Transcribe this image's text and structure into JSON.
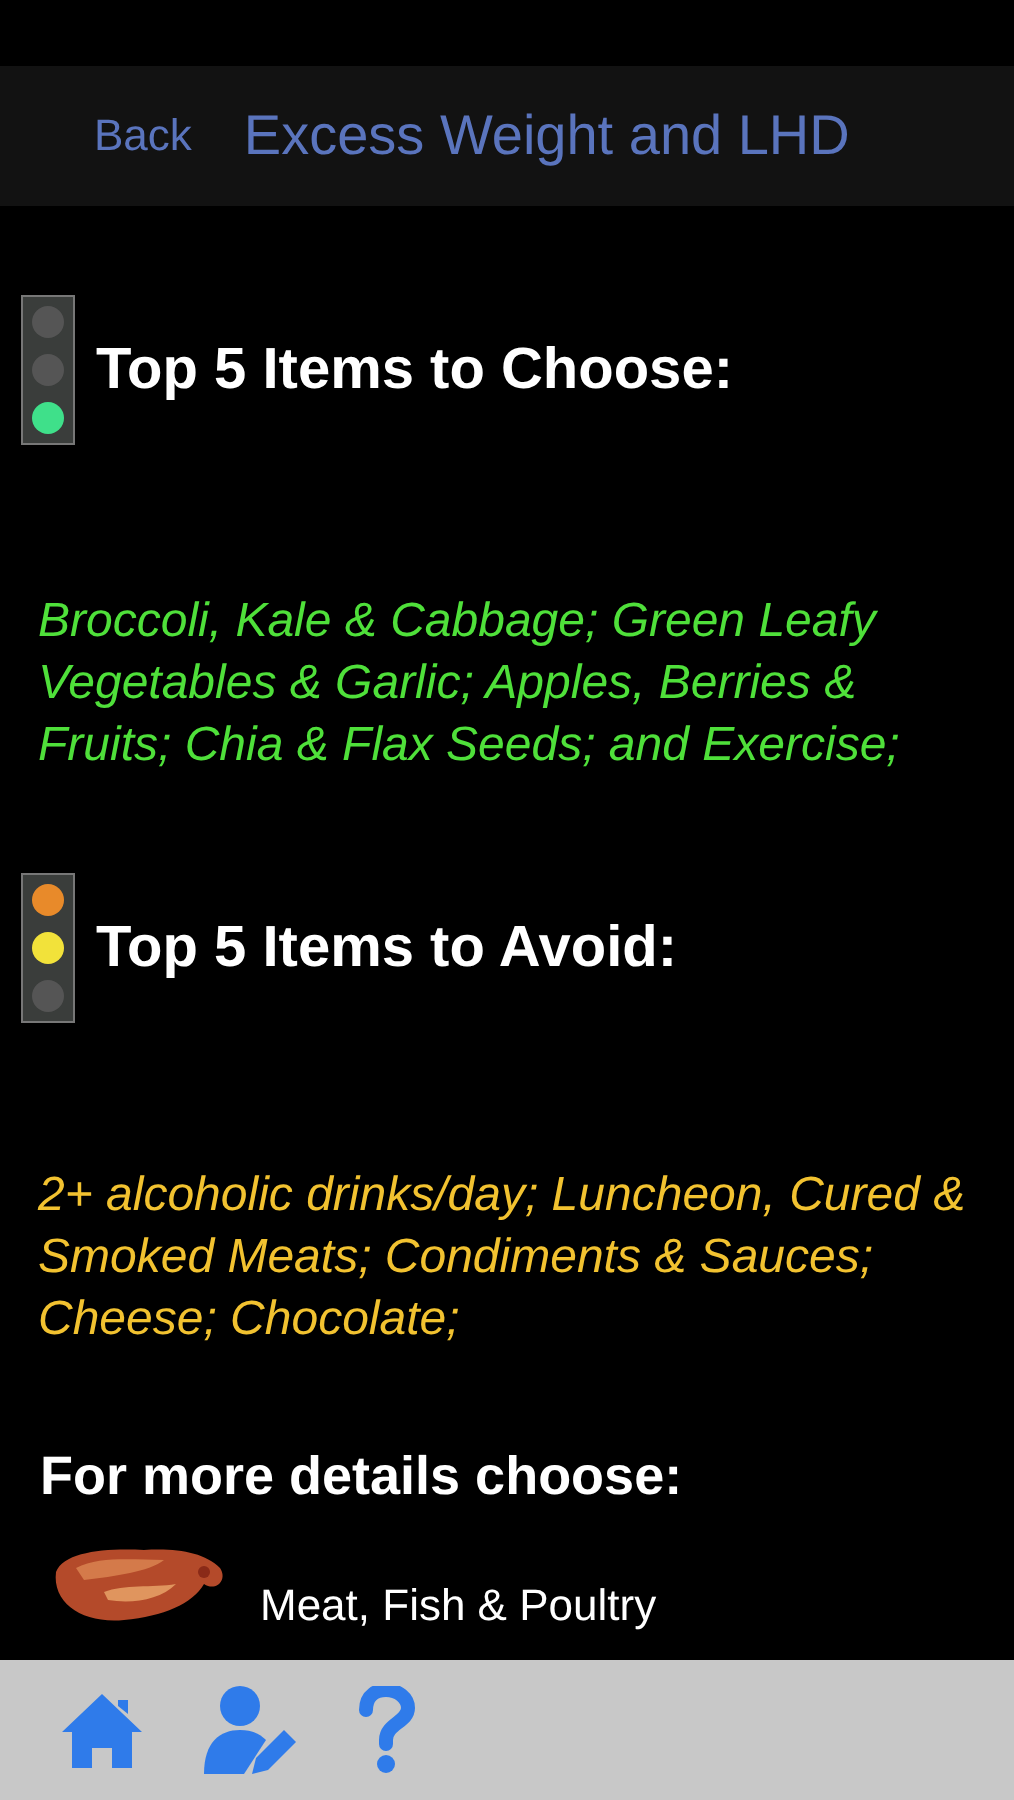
{
  "nav_bar": {
    "back": "Back",
    "title": "Excess Weight and LHD"
  },
  "sections": [
    {
      "kind": "choose",
      "heading": "Top 5 Items to Choose:",
      "text": "Broccoli, Kale & Cabbage; Green Leafy Vegetables & Garlic; Apples, Berries & Fruits; Chia & Flax Seeds;  and Exercise;",
      "color": "#4fe03a"
    },
    {
      "kind": "avoid",
      "heading": "Top 5 Items to Avoid:",
      "text": "2+ alcoholic drinks/day; Luncheon, Cured & Smoked Meats; Condiments & Sauces; Cheese; Chocolate;",
      "color": "#f2c230"
    }
  ],
  "details": {
    "heading": "For more details choose:",
    "items": [
      {
        "label": "Meat, Fish & Poultry",
        "kind": "picture"
      }
    ]
  },
  "tab_bar": {
    "items": [
      {
        "kind": "home"
      },
      {
        "kind": "profile"
      },
      {
        "kind": "help"
      }
    ]
  }
}
